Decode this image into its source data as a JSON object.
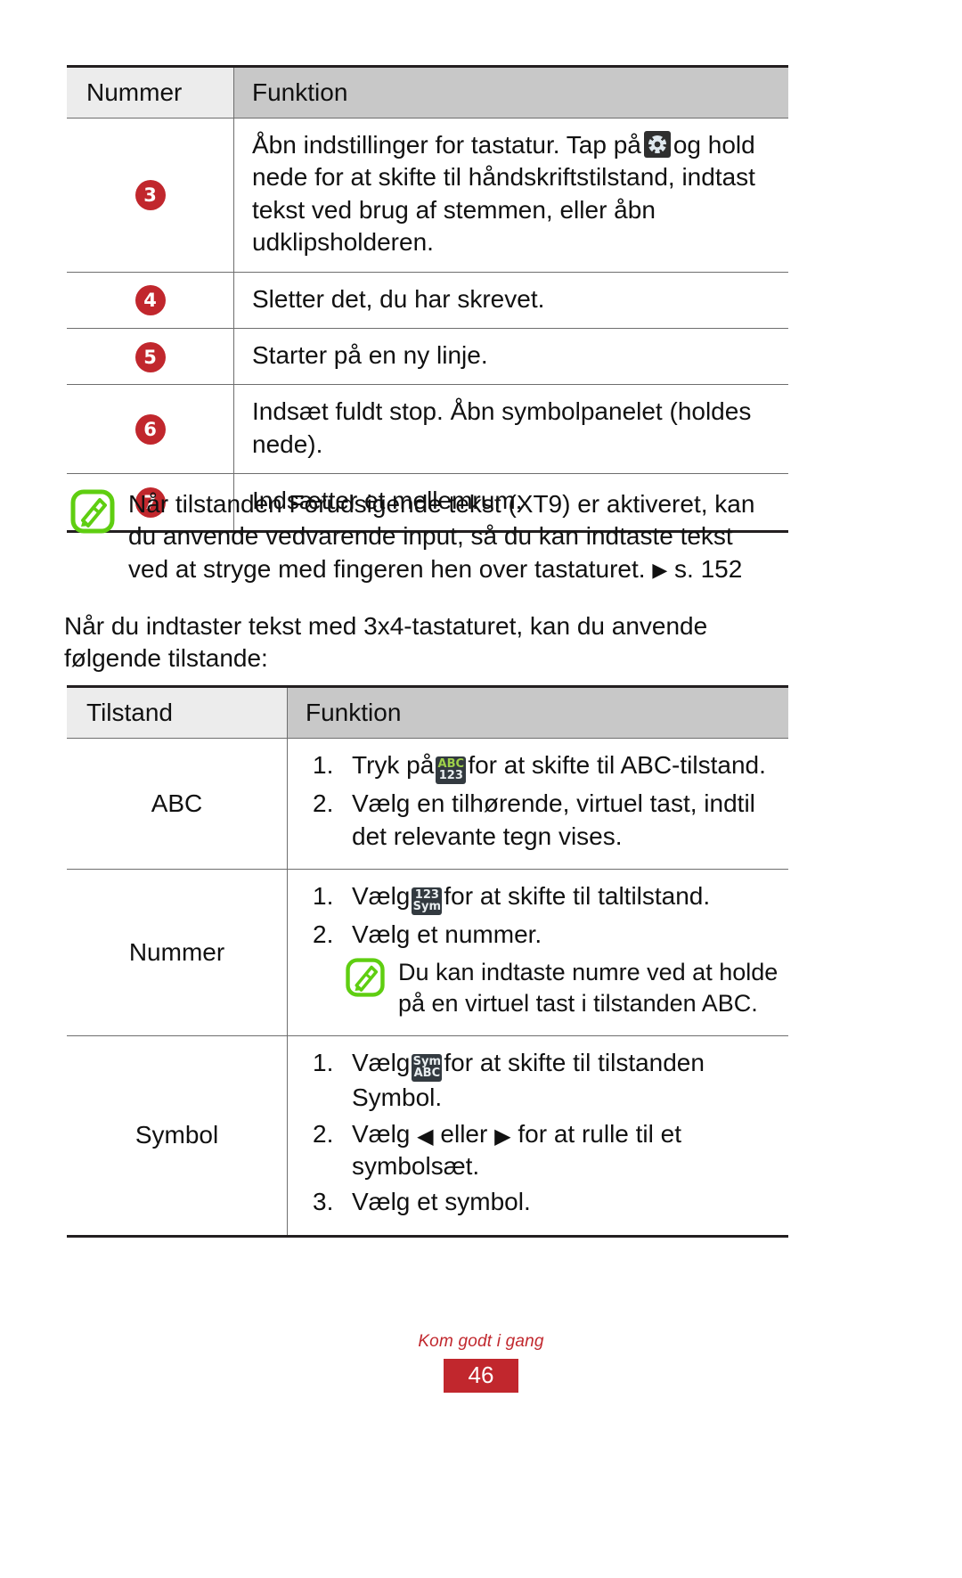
{
  "table1": {
    "headers": [
      "Nummer",
      "Funktion"
    ],
    "rows": [
      {
        "num": "3",
        "text_before": "Åbn indstillinger for tastatur. Tap på",
        "icon": "gear-icon",
        "text_after": "og hold nede for at skifte til håndskriftstilstand, indtast tekst ved brug af stemmen, eller åbn udklipsholderen."
      },
      {
        "num": "4",
        "text": "Sletter det, du har skrevet."
      },
      {
        "num": "5",
        "text": "Starter på en ny linje."
      },
      {
        "num": "6",
        "text": "Indsæt fuldt stop. Åbn symbolpanelet (holdes nede)."
      },
      {
        "num": "7",
        "text": "Indsætter et mellemrum."
      }
    ]
  },
  "note1": {
    "icon": "note-pencil-icon",
    "line1": "Når tilstanden Forudsigende tekst (XT9) er aktiveret, kan",
    "line2": "du anvende vedvarende input, så du kan indtaste tekst",
    "line3_a": "ved at stryge med fingeren hen over tastaturet.",
    "arrow": "▶",
    "line3_b": "s. 152"
  },
  "intro": {
    "line1": "Når du indtaster tekst med 3x4-tastaturet, kan du anvende",
    "line2": "følgende tilstande:"
  },
  "table2": {
    "headers": [
      "Tilstand",
      "Funktion"
    ],
    "rows": [
      {
        "mode": "ABC",
        "steps": [
          {
            "index": "1.",
            "before": "Tryk på",
            "icon": {
              "name": "abc-123-key-icon",
              "top": "ABC",
              "bottom": "123",
              "top_green": true
            },
            "after": "for at skifte til ABC-tilstand."
          },
          {
            "index": "2.",
            "text": "Vælg en tilhørende, virtuel tast, indtil det relevante tegn vises."
          }
        ]
      },
      {
        "mode": "Nummer",
        "steps": [
          {
            "index": "1.",
            "before": "Vælg",
            "icon": {
              "name": "123-sym-key-icon",
              "top": "123",
              "bottom": "Sym",
              "top_green": false
            },
            "after": "for at skifte til taltilstand."
          },
          {
            "index": "2.",
            "text": "Vælg et nummer."
          }
        ],
        "note": {
          "icon": "note-pencil-icon",
          "line1": "Du kan indtaste numre ved at holde",
          "line2": "på en virtuel tast i tilstanden ABC."
        }
      },
      {
        "mode": "Symbol",
        "steps": [
          {
            "index": "1.",
            "before": "Vælg",
            "icon": {
              "name": "sym-abc-key-icon",
              "top": "Sym",
              "bottom": "ABC",
              "top_green": false
            },
            "after": "for at skifte til tilstanden Symbol."
          },
          {
            "index": "2.",
            "before2": "Vælg",
            "arrow_left": "◀",
            "mid": "eller",
            "arrow_right": "▶",
            "after2": "for at rulle til et symbolsæt."
          },
          {
            "index": "3.",
            "text": "Vælg et symbol."
          }
        ]
      }
    ]
  },
  "footer": {
    "section": "Kom godt i gang",
    "page": "46"
  },
  "colors": {
    "accent_red": "#c1272d",
    "note_green": "#5fce11",
    "header_mode_bg": "#ececec",
    "header_fn_bg": "#c8c8c8",
    "key_icon_bg": "#333a40"
  }
}
